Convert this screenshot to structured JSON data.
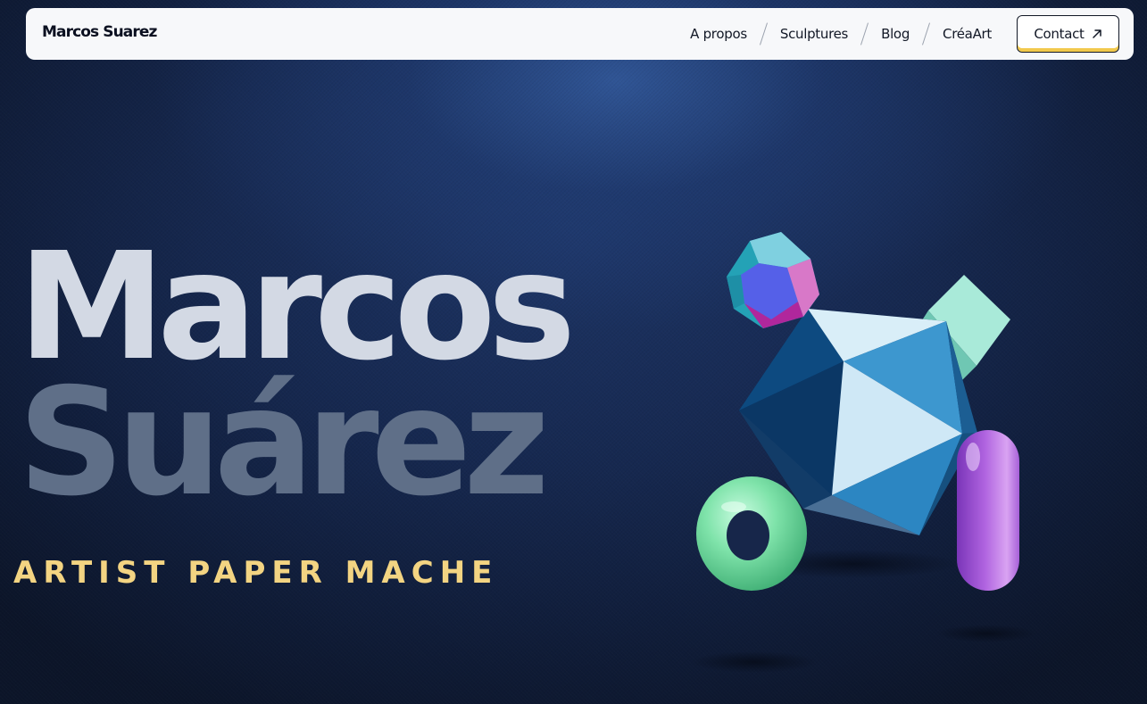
{
  "header": {
    "brand": "Marcos Suarez",
    "nav": [
      {
        "label": "A propos"
      },
      {
        "label": "Sculptures"
      },
      {
        "label": "Blog"
      },
      {
        "label": "CréaArt"
      }
    ],
    "contact_label": "Contact",
    "contact_icon": "arrow-up-right-icon"
  },
  "hero": {
    "first_name": "Marcos",
    "last_name": "Suárez",
    "tagline": "ARTIST PAPER MACHE"
  },
  "colors": {
    "background": "#14264b",
    "nav_bg": "#f7f8fa",
    "first_name": "#d3d9e4",
    "last_name": "#5f6f88",
    "tagline": "#f3d482",
    "contact_underline": "#f2c94c"
  }
}
